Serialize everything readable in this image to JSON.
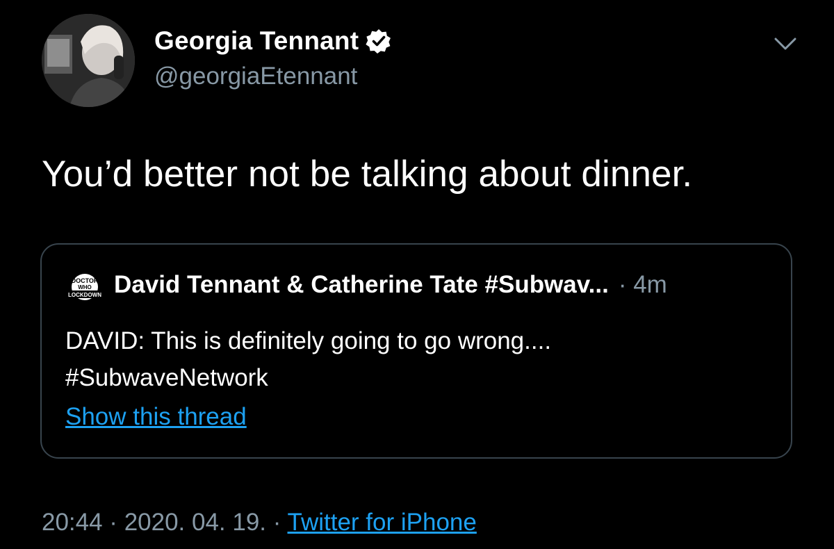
{
  "tweet": {
    "author": {
      "display_name": "Georgia Tennant",
      "handle": "@georgiaEtennant",
      "verified_icon": "verified-badge-icon"
    },
    "menu_icon": "chevron-down-icon",
    "text": "You’d better not be talking about dinner.",
    "quoted_tweet": {
      "avatar_logo_lines": [
        "DOCTOR",
        "WHO",
        "LOCKDOWN"
      ],
      "author_name": "David Tennant & Catherine Tate #Subwav...",
      "time": "· 4m",
      "text_lines": [
        "DAVID: This is definitely going to go wrong....",
        "#SubwaveNetwork"
      ],
      "thread_link": "Show this thread"
    },
    "timestamp": "20:44 · 2020. 04. 19. ·",
    "source": "Twitter for iPhone"
  },
  "colors": {
    "background": "#000000",
    "text_primary": "#ffffff",
    "text_secondary": "#8899a6",
    "link": "#1da1f2",
    "border": "#38444d"
  }
}
